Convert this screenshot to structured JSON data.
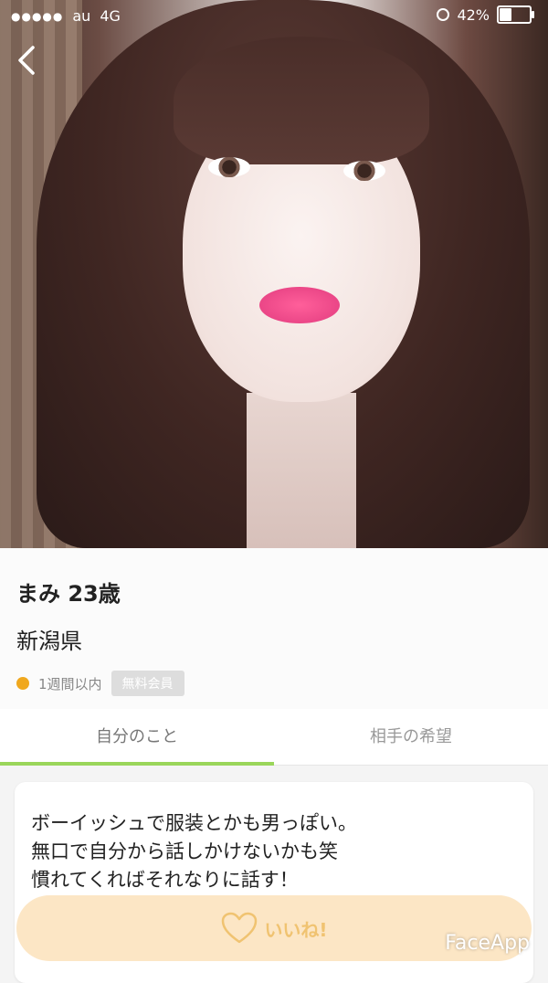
{
  "status_bar": {
    "carrier": "au",
    "network": "4G",
    "battery_percent": "42%",
    "battery_level": 0.42
  },
  "profile": {
    "name_age": "まみ 23歳",
    "prefecture": "新潟県",
    "last_login": "1週間以内",
    "membership": "無料会員"
  },
  "tabs": [
    {
      "label": "自分のこと",
      "active": true
    },
    {
      "label": "相手の希望",
      "active": false
    }
  ],
  "bio": "ボーイッシュで服装とかも男っぽい。\n無口で自分から話しかけないかも笑\n慣れてくればそれなりに話す！",
  "like_button": {
    "label": "いいね!"
  },
  "watermark": "FaceApp",
  "colors": {
    "accent_green": "#9ad65a",
    "like_bg": "#fce5c2",
    "like_fg": "#f0c06a",
    "online_dot": "#f0a81e"
  }
}
